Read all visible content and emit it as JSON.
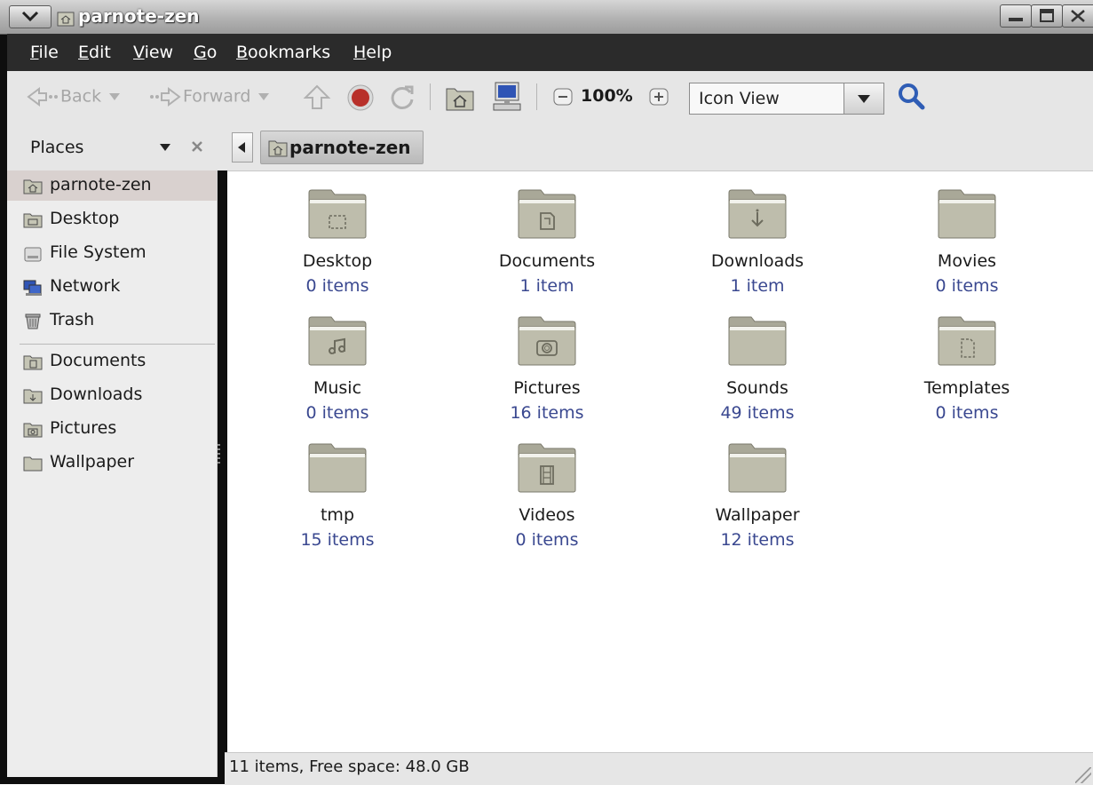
{
  "window": {
    "title": "parnote-zen"
  },
  "menubar": {
    "items": [
      {
        "label": "File",
        "key": "F",
        "rest": "ile"
      },
      {
        "label": "Edit",
        "key": "E",
        "rest": "dit"
      },
      {
        "label": "View",
        "key": "V",
        "rest": "iew"
      },
      {
        "label": "Go",
        "key": "G",
        "rest": "o"
      },
      {
        "label": "Bookmarks",
        "key": "B",
        "rest": "ookmarks"
      },
      {
        "label": "Help",
        "key": "H",
        "rest": "elp"
      }
    ]
  },
  "toolbar": {
    "back_label": "Back",
    "forward_label": "Forward",
    "zoom": "100%",
    "view_mode": "Icon View"
  },
  "sidebar": {
    "header": "Places",
    "places": [
      {
        "label": "parnote-zen",
        "icon": "home-folder-icon"
      },
      {
        "label": "Desktop",
        "icon": "desktop-folder-icon"
      },
      {
        "label": "File System",
        "icon": "drive-icon"
      },
      {
        "label": "Network",
        "icon": "network-icon"
      },
      {
        "label": "Trash",
        "icon": "trash-icon"
      }
    ],
    "bookmarks": [
      {
        "label": "Documents",
        "icon": "documents-folder-icon"
      },
      {
        "label": "Downloads",
        "icon": "downloads-folder-icon"
      },
      {
        "label": "Pictures",
        "icon": "pictures-folder-icon"
      },
      {
        "label": "Wallpaper",
        "icon": "folder-icon"
      }
    ]
  },
  "pathbar": {
    "current": "parnote-zen"
  },
  "items": [
    {
      "name": "Desktop",
      "count": "0 items",
      "emblem": "desktop"
    },
    {
      "name": "Documents",
      "count": "1 item",
      "emblem": "document"
    },
    {
      "name": "Downloads",
      "count": "1 item",
      "emblem": "download"
    },
    {
      "name": "Movies",
      "count": "0 items",
      "emblem": ""
    },
    {
      "name": "Music",
      "count": "0 items",
      "emblem": "music"
    },
    {
      "name": "Pictures",
      "count": "16 items",
      "emblem": "camera"
    },
    {
      "name": "Sounds",
      "count": "49 items",
      "emblem": ""
    },
    {
      "name": "Templates",
      "count": "0 items",
      "emblem": "template"
    },
    {
      "name": "tmp",
      "count": "15 items",
      "emblem": ""
    },
    {
      "name": "Videos",
      "count": "0 items",
      "emblem": "film"
    },
    {
      "name": "Wallpaper",
      "count": "12 items",
      "emblem": ""
    }
  ],
  "status": {
    "text": "11 items, Free space: 48.0 GB"
  },
  "colors": {
    "menubar": "#2b2b2b",
    "count_text": "#3a4890",
    "selection": "#d9d1cf",
    "folder": "#bebdac"
  }
}
